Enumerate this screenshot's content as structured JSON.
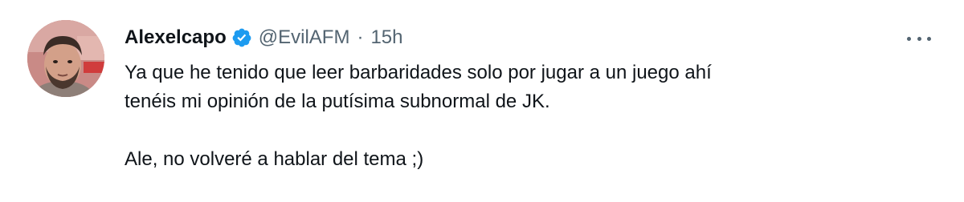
{
  "tweet": {
    "author": {
      "display_name": "Alexelcapo",
      "handle": "@EvilAFM",
      "verified": true,
      "verified_color": "#1d9bf0"
    },
    "separator": "·",
    "timestamp": "15h",
    "more_icon": "more-horizontal-icon",
    "text_lines": [
      "Ya que he tenido que leer barbaridades solo por jugar a un juego ahí",
      "tenéis mi opinión de la putísima subnormal de JK."
    ],
    "text_para2": "Ale, no volveré a hablar del tema ;)"
  }
}
